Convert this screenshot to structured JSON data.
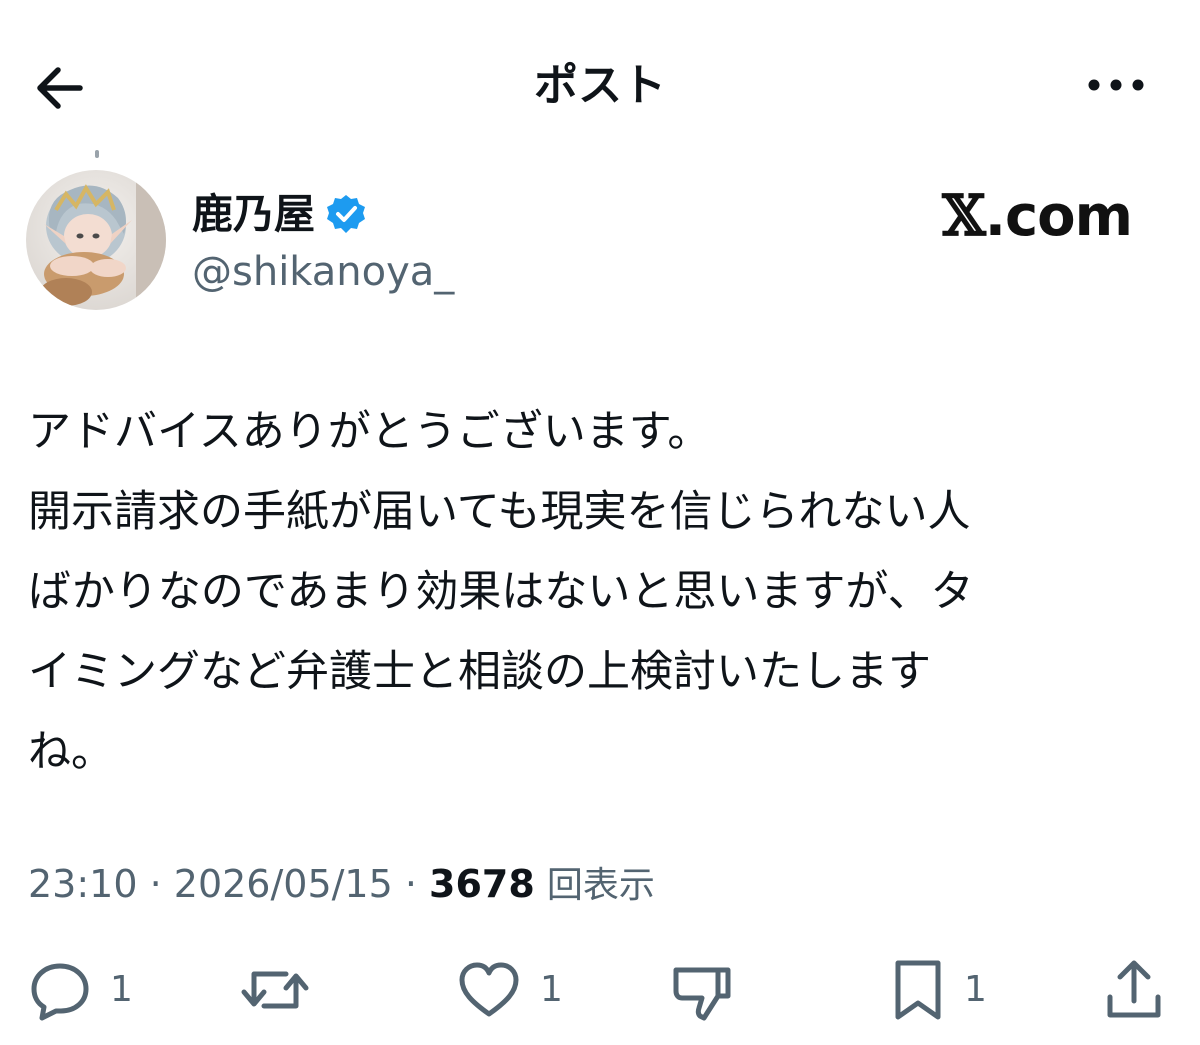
{
  "header": {
    "title": "ポスト",
    "back_icon": "arrow-left-icon",
    "more_icon": "more-horizontal-icon"
  },
  "author": {
    "display_name": "鹿乃屋",
    "handle": "@shikanoya_",
    "verified": true,
    "verified_color": "#1d9bf0"
  },
  "watermark": {
    "x_symbol": "𝕏",
    "domain_suffix": ".com"
  },
  "tweet": {
    "lines": [
      "アドバイスありがとうございます。",
      "開示請求の手紙が届いても現実を信じられない人",
      "ばかりなのであまり効果はないと思いますが、タ",
      "イミングなど弁護士と相談の上検討いたします",
      "ね。"
    ]
  },
  "meta": {
    "time": "23:10",
    "sep1": " · ",
    "date": "2026/05/15",
    "sep2": " · ",
    "views_count": "3678",
    "views_label": "回表示"
  },
  "actions": {
    "reply_count": "1",
    "like_count": "1",
    "bookmark_count": "1"
  },
  "colors": {
    "text": "#0f1419",
    "secondary": "#536471",
    "icon": "#536471"
  }
}
